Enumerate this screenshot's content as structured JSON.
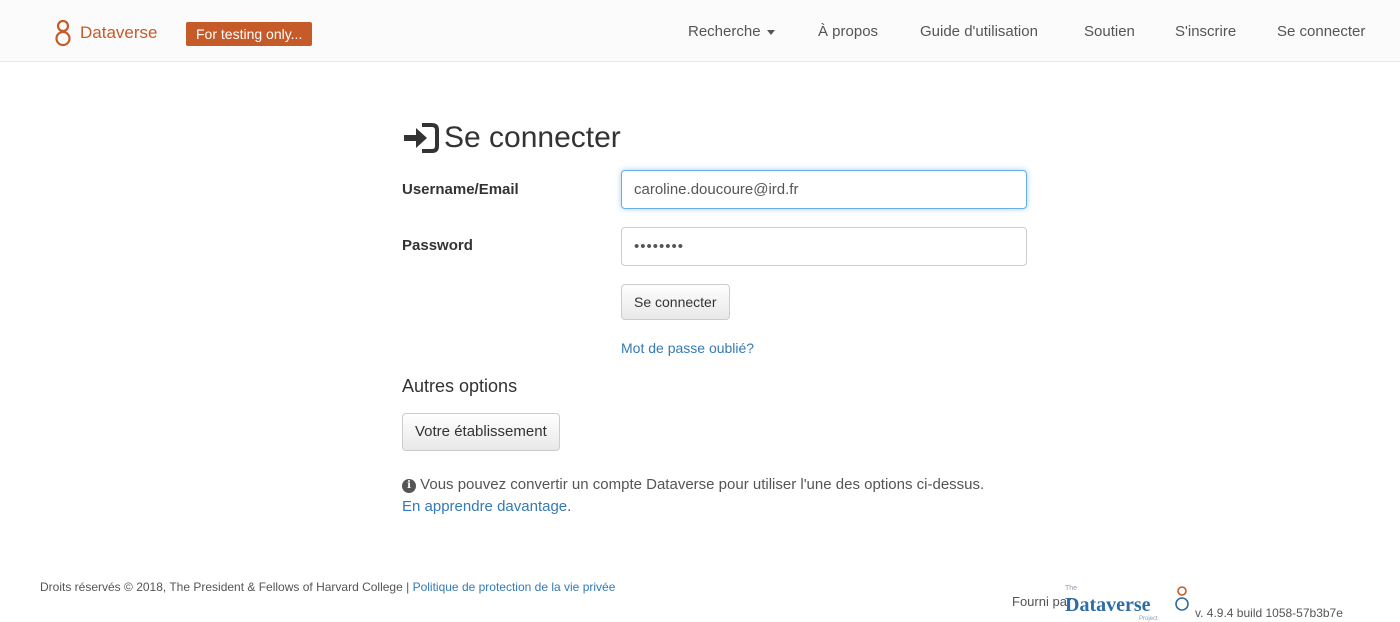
{
  "header": {
    "brand": "Dataverse",
    "badge": "For testing only...",
    "nav": {
      "search": "Recherche",
      "about": "À propos",
      "guide": "Guide d'utilisation",
      "support": "Soutien",
      "signup": "S'inscrire",
      "login": "Se connecter"
    }
  },
  "login": {
    "title": "Se connecter",
    "username_label": "Username/Email",
    "username_value": "caroline.doucoure@ird.fr",
    "password_label": "Password",
    "password_value": "••••••••",
    "submit_label": "Se connecter",
    "forgot_link": "Mot de passe oublié?"
  },
  "other_options": {
    "title": "Autres options",
    "institution_button": "Votre établissement",
    "info_text": "Vous pouvez convertir un compte Dataverse pour utiliser l'une des options ci-dessus.",
    "learn_more": "En apprendre davantage"
  },
  "footer": {
    "copyright": "Droits réservés © 2018, The President & Fellows of Harvard College |",
    "privacy_link": "Politique de protection de la vie privée",
    "powered_by": "Fourni par",
    "logo_the": "The",
    "logo_name": "Dataverse",
    "logo_project": "Project",
    "version": "v. 4.9.4 build 1058-57b3b7e"
  },
  "colors": {
    "brand": "#c55b28",
    "link": "#337ab7",
    "focus": "#66afe9"
  },
  "icons": {
    "brand_logo": "dataverse-logo-icon",
    "login_icon": "sign-in-icon",
    "info_icon": "info-circle-icon",
    "search_caret": "caret-down-icon"
  }
}
